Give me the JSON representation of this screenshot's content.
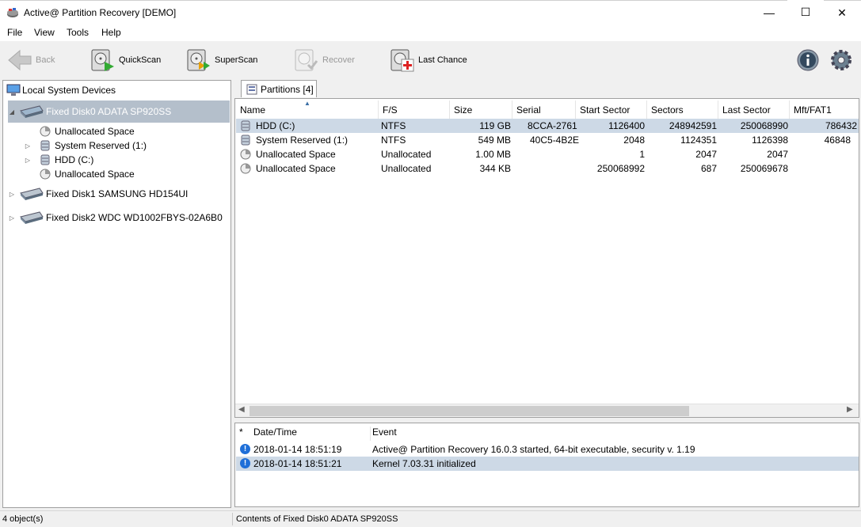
{
  "window": {
    "title": "Active@ Partition Recovery [DEMO]",
    "minimize_glyph": "—",
    "maximize_glyph": "☐",
    "close_glyph": "✕"
  },
  "menu": [
    "File",
    "View",
    "Tools",
    "Help"
  ],
  "toolbar": {
    "back": "Back",
    "quickscan": "QuickScan",
    "superscan": "SuperScan",
    "recover": "Recover",
    "lastchance": "Last Chance",
    "info_icon": "info-icon",
    "settings_icon": "gear-icon"
  },
  "tree": {
    "root": "Local System Devices",
    "disk0": {
      "label": "Fixed Disk0 ADATA SP920SS",
      "children": [
        "Unallocated Space",
        "System Reserved (1:)",
        "HDD (C:)",
        "Unallocated Space"
      ]
    },
    "disk1": "Fixed Disk1 SAMSUNG HD154UI",
    "disk2": "Fixed Disk2 WDC WD1002FBYS-02A6B0"
  },
  "tab": {
    "label": "Partitions [4]"
  },
  "grid": {
    "columns": [
      "Name",
      "F/S",
      "Size",
      "Serial",
      "Start Sector",
      "Sectors",
      "Last Sector",
      "Mft/FAT1"
    ],
    "rows": [
      {
        "name": "HDD (C:)",
        "fs": "NTFS",
        "size": "119 GB",
        "serial": "8CCA-2761",
        "start": "1126400",
        "sectors": "248942591",
        "last": "250068990",
        "mft": "786432"
      },
      {
        "name": "System Reserved (1:)",
        "fs": "NTFS",
        "size": "549 MB",
        "serial": "40C5-4B2E",
        "start": "2048",
        "sectors": "1124351",
        "last": "1126398",
        "mft": "46848"
      },
      {
        "name": "Unallocated Space",
        "fs": "Unallocated",
        "size": "1.00 MB",
        "serial": "",
        "start": "1",
        "sectors": "2047",
        "last": "2047",
        "mft": ""
      },
      {
        "name": "Unallocated Space",
        "fs": "Unallocated",
        "size": "344 KB",
        "serial": "",
        "start": "250068992",
        "sectors": "687",
        "last": "250069678",
        "mft": ""
      }
    ]
  },
  "log": {
    "columns": [
      "*",
      "Date/Time",
      "Event"
    ],
    "rows": [
      {
        "datetime": "2018-01-14 18:51:19",
        "event": "Active@ Partition Recovery 16.0.3 started, 64-bit executable, security v. 1.19"
      },
      {
        "datetime": "2018-01-14 18:51:21",
        "event": "Kernel 7.03.31 initialized"
      }
    ]
  },
  "status": {
    "left": "4 object(s)",
    "right": "Contents of Fixed Disk0 ADATA SP920SS"
  },
  "colors": {
    "selection": "#cce8ff",
    "selected_tree": "#b4bfcb",
    "accent": "#1f6fd8"
  }
}
